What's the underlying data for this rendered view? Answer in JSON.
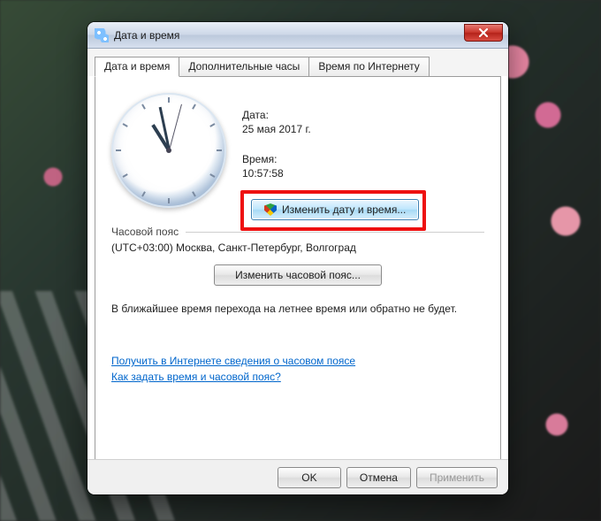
{
  "window": {
    "title": "Дата и время"
  },
  "tabs": {
    "tab1": "Дата и время",
    "tab2": "Дополнительные часы",
    "tab3": "Время по Интернету"
  },
  "date": {
    "label": "Дата:",
    "value": "25 мая 2017 г."
  },
  "time": {
    "label": "Время:",
    "value": "10:57:58"
  },
  "buttons": {
    "change_datetime": "Изменить дату и время...",
    "change_timezone": "Изменить часовой пояс...",
    "ok": "OK",
    "cancel": "Отмена",
    "apply": "Применить"
  },
  "timezone": {
    "section_label": "Часовой пояс",
    "value": "(UTC+03:00) Москва, Санкт-Петербург, Волгоград"
  },
  "dst_note": "В ближайшее время перехода на летнее время или обратно не будет.",
  "links": {
    "learn_tz": "Получить в Интернете сведения о часовом поясе",
    "howto": "Как задать время и часовой пояс?"
  }
}
